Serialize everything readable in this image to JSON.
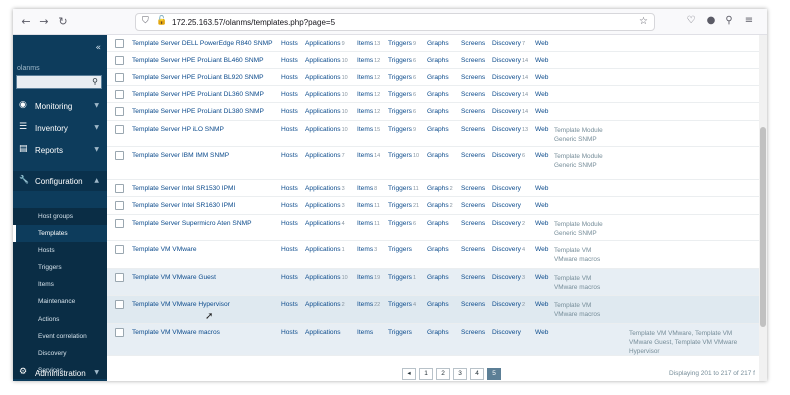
{
  "browser": {
    "url": "172.25.163.57/olanms/templates.php?page=5",
    "back_icon": "←",
    "forward_icon": "→",
    "reload_icon": "↻"
  },
  "sidebar": {
    "collapse_icon": "«",
    "user": "olanms",
    "search_placeholder": "",
    "menu": [
      {
        "label": "Monitoring",
        "icon": "◉"
      },
      {
        "label": "Inventory",
        "icon": "☰"
      },
      {
        "label": "Reports",
        "icon": "▤"
      },
      {
        "label": "Configuration",
        "icon": "🔧"
      }
    ],
    "submenu": [
      "Host groups",
      "Templates",
      "Hosts",
      "Triggers",
      "Items",
      "Maintenance",
      "Actions",
      "Event correlation",
      "Discovery",
      "Services"
    ],
    "admin": {
      "label": "Administration",
      "icon": "⚙"
    }
  },
  "table": {
    "rows": [
      {
        "name": "Template Server DELL PowerEdge R840 SNMP",
        "hosts": "Hosts",
        "applications": "Applications",
        "app_count": "9",
        "items": "Items",
        "items_count": "13",
        "triggers": "Triggers",
        "triggers_count": "9",
        "graphs": "Graphs",
        "graphs_count": "",
        "screens": "Screens",
        "discovery": "Discovery",
        "discovery_count": "7",
        "web": "Web",
        "linked": "",
        "linked_to": ""
      },
      {
        "name": "Template Server HPE ProLiant BL460 SNMP",
        "hosts": "Hosts",
        "applications": "Applications",
        "app_count": "10",
        "items": "Items",
        "items_count": "12",
        "triggers": "Triggers",
        "triggers_count": "6",
        "graphs": "Graphs",
        "graphs_count": "",
        "screens": "Screens",
        "discovery": "Discovery",
        "discovery_count": "14",
        "web": "Web",
        "linked": "",
        "linked_to": ""
      },
      {
        "name": "Template Server HPE ProLiant BL920 SNMP",
        "hosts": "Hosts",
        "applications": "Applications",
        "app_count": "10",
        "items": "Items",
        "items_count": "12",
        "triggers": "Triggers",
        "triggers_count": "6",
        "graphs": "Graphs",
        "graphs_count": "",
        "screens": "Screens",
        "discovery": "Discovery",
        "discovery_count": "14",
        "web": "Web",
        "linked": "",
        "linked_to": ""
      },
      {
        "name": "Template Server HPE ProLiant DL360 SNMP",
        "hosts": "Hosts",
        "applications": "Applications",
        "app_count": "10",
        "items": "Items",
        "items_count": "12",
        "triggers": "Triggers",
        "triggers_count": "6",
        "graphs": "Graphs",
        "graphs_count": "",
        "screens": "Screens",
        "discovery": "Discovery",
        "discovery_count": "14",
        "web": "Web",
        "linked": "",
        "linked_to": ""
      },
      {
        "name": "Template Server HPE ProLiant DL380 SNMP",
        "hosts": "Hosts",
        "applications": "Applications",
        "app_count": "10",
        "items": "Items",
        "items_count": "12",
        "triggers": "Triggers",
        "triggers_count": "6",
        "graphs": "Graphs",
        "graphs_count": "",
        "screens": "Screens",
        "discovery": "Discovery",
        "discovery_count": "14",
        "web": "Web",
        "linked": "",
        "linked_to": ""
      },
      {
        "name": "Template Server HP iLO SNMP",
        "hosts": "Hosts",
        "applications": "Applications",
        "app_count": "10",
        "items": "Items",
        "items_count": "15",
        "triggers": "Triggers",
        "triggers_count": "9",
        "graphs": "Graphs",
        "graphs_count": "",
        "screens": "Screens",
        "discovery": "Discovery",
        "discovery_count": "13",
        "web": "Web",
        "linked": "Template Module Generic SNMP",
        "linked_to": ""
      },
      {
        "name": "Template Server IBM IMM SNMP",
        "hosts": "Hosts",
        "applications": "Applications",
        "app_count": "7",
        "items": "Items",
        "items_count": "14",
        "triggers": "Triggers",
        "triggers_count": "10",
        "graphs": "Graphs",
        "graphs_count": "",
        "screens": "Screens",
        "discovery": "Discovery",
        "discovery_count": "6",
        "web": "Web",
        "linked": "Template Module Generic SNMP",
        "linked_to": ""
      },
      {
        "name": "Template Server Intel SR1530 IPMI",
        "hosts": "Hosts",
        "applications": "Applications",
        "app_count": "3",
        "items": "Items",
        "items_count": "8",
        "triggers": "Triggers",
        "triggers_count": "11",
        "graphs": "Graphs",
        "graphs_count": "2",
        "screens": "Screens",
        "discovery": "Discovery",
        "discovery_count": "",
        "web": "Web",
        "linked": "",
        "linked_to": ""
      },
      {
        "name": "Template Server Intel SR1630 IPMI",
        "hosts": "Hosts",
        "applications": "Applications",
        "app_count": "3",
        "items": "Items",
        "items_count": "11",
        "triggers": "Triggers",
        "triggers_count": "21",
        "graphs": "Graphs",
        "graphs_count": "2",
        "screens": "Screens",
        "discovery": "Discovery",
        "discovery_count": "",
        "web": "Web",
        "linked": "",
        "linked_to": ""
      },
      {
        "name": "Template Server Supermicro Aten SNMP",
        "hosts": "Hosts",
        "applications": "Applications",
        "app_count": "4",
        "items": "Items",
        "items_count": "11",
        "triggers": "Triggers",
        "triggers_count": "6",
        "graphs": "Graphs",
        "graphs_count": "",
        "screens": "Screens",
        "discovery": "Discovery",
        "discovery_count": "2",
        "web": "Web",
        "linked": "Template Module Generic SNMP",
        "linked_to": ""
      },
      {
        "name": "Template VM VMware",
        "hosts": "Hosts",
        "applications": "Applications",
        "app_count": "1",
        "items": "Items",
        "items_count": "3",
        "triggers": "Triggers",
        "triggers_count": "",
        "graphs": "Graphs",
        "graphs_count": "",
        "screens": "Screens",
        "discovery": "Discovery",
        "discovery_count": "4",
        "web": "Web",
        "linked": "Template VM VMware macros",
        "linked_to": ""
      },
      {
        "name": "Template VM VMware Guest",
        "hosts": "Hosts",
        "applications": "Applications",
        "app_count": "10",
        "items": "Items",
        "items_count": "19",
        "triggers": "Triggers",
        "triggers_count": "1",
        "graphs": "Graphs",
        "graphs_count": "",
        "screens": "Screens",
        "discovery": "Discovery",
        "discovery_count": "3",
        "web": "Web",
        "linked": "Template VM VMware macros",
        "linked_to": ""
      },
      {
        "name": "Template VM VMware Hypervisor",
        "hosts": "Hosts",
        "applications": "Applications",
        "app_count": "2",
        "items": "Items",
        "items_count": "22",
        "triggers": "Triggers",
        "triggers_count": "4",
        "graphs": "Graphs",
        "graphs_count": "",
        "screens": "Screens",
        "discovery": "Discovery",
        "discovery_count": "2",
        "web": "Web",
        "linked": "Template VM VMware macros",
        "linked_to": ""
      },
      {
        "name": "Template VM VMware macros",
        "hosts": "Hosts",
        "applications": "Applications",
        "app_count": "",
        "items": "Items",
        "items_count": "",
        "triggers": "Triggers",
        "triggers_count": "",
        "graphs": "Graphs",
        "graphs_count": "",
        "screens": "Screens",
        "discovery": "Discovery",
        "discovery_count": "",
        "web": "Web",
        "linked": "",
        "linked_to": "Template VM VMware, Template VM VMware Guest, Template VM VMware Hypervisor"
      }
    ]
  },
  "pagination": {
    "prev_icon": "◂",
    "pages": [
      "1",
      "2",
      "3",
      "4",
      "5"
    ],
    "current": "5",
    "display_info": "Displaying 201 to 217 of 217 f"
  }
}
